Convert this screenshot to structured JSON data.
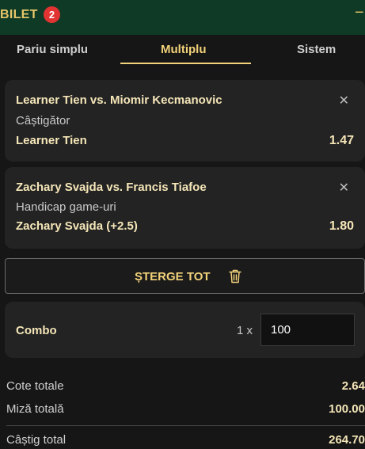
{
  "header": {
    "title": "BILET",
    "badge": "2",
    "collapse_icon": "minus-icon"
  },
  "tabs": [
    {
      "label": "Pariu simplu",
      "active": false
    },
    {
      "label": "Multiplu",
      "active": true
    },
    {
      "label": "Sistem",
      "active": false
    }
  ],
  "bets": [
    {
      "match": "Learner Tien vs. Miomir Kecmanovic",
      "market": "Câștigător",
      "pick": "Learner Tien",
      "odds": "1.47"
    },
    {
      "match": "Zachary Svajda vs. Francis Tiafoe",
      "market": "Handicap game-uri",
      "pick": "Zachary Svajda (+2.5)",
      "odds": "1.80"
    }
  ],
  "clear_button": {
    "label": "ȘTERGE TOT",
    "icon": "trash-icon"
  },
  "combo": {
    "label": "Combo",
    "multiplier": "1 x",
    "stake": "100"
  },
  "summary": {
    "total_odds_label": "Cote totale",
    "total_odds": "2.64",
    "total_stake_label": "Miză totală",
    "total_stake": "100.00",
    "total_win_label": "Câștig total",
    "total_win": "264.70"
  },
  "colors": {
    "header_bg": "#0f3a25",
    "accent": "#f2d27a",
    "card_bg": "#232323",
    "badge": "#e23333"
  }
}
